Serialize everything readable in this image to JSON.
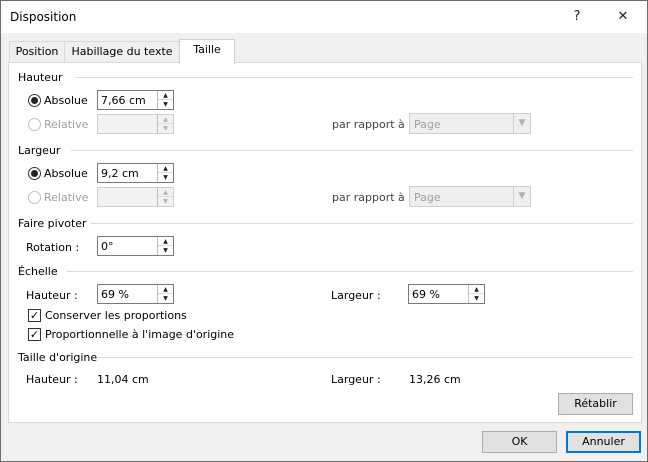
{
  "window": {
    "title": "Disposition",
    "help": "?",
    "close": "✕"
  },
  "tabs": [
    {
      "label": "Position"
    },
    {
      "label": "Habillage du texte"
    },
    {
      "label": "Taille"
    }
  ],
  "hauteur": {
    "section": "Hauteur",
    "absolue_label": "Absolue",
    "absolue_value": "7,66 cm",
    "relative_label": "Relative",
    "relative_value": "",
    "par_rapport_label": "par rapport à",
    "par_rapport_value": "Page"
  },
  "largeur": {
    "section": "Largeur",
    "absolue_label": "Absolue",
    "absolue_value": "9,2 cm",
    "relative_label": "Relative",
    "relative_value": "",
    "par_rapport_label": "par rapport à",
    "par_rapport_value": "Page"
  },
  "pivoter": {
    "section": "Faire pivoter",
    "rotation_label": "Rotation :",
    "rotation_value": "0°"
  },
  "echelle": {
    "section": "Échelle",
    "hauteur_label": "Hauteur :",
    "hauteur_value": "69 %",
    "largeur_label": "Largeur :",
    "largeur_value": "69 %",
    "conserver_label": "Conserver les proportions",
    "conserver_checked": true,
    "proportionnelle_label": "Proportionnelle à l'image d'origine",
    "proportionnelle_checked": true
  },
  "origine": {
    "section": "Taille d'origine",
    "hauteur_label": "Hauteur :",
    "hauteur_value": "11,04 cm",
    "largeur_label": "Largeur :",
    "largeur_value": "13,26 cm"
  },
  "buttons": {
    "retablir": "Rétablir",
    "ok": "OK",
    "annuler": "Annuler"
  }
}
